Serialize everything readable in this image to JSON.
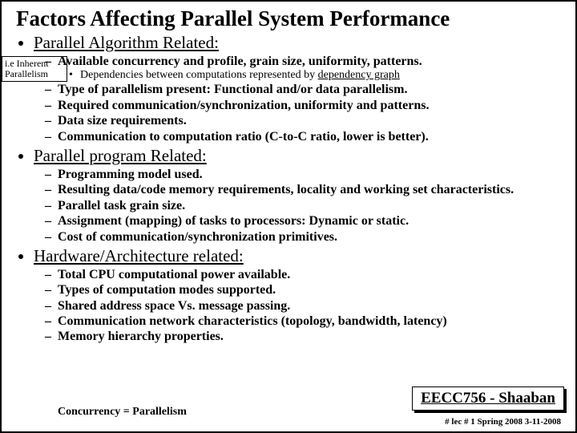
{
  "title": "Factors Affecting Parallel System Performance",
  "callout": "i.e Inherent Parallelism",
  "sections": [
    {
      "heading": "Parallel Algorithm Related:",
      "items": [
        {
          "text": "Available concurrency and profile, grain size, uniformity, patterns."
        },
        {
          "dep": {
            "pre": "Dependencies between computations represented by ",
            "und": "dependency graph"
          }
        },
        {
          "text": "Type of parallelism present: Functional and/or data parallelism."
        },
        {
          "text": "Required communication/synchronization, uniformity and patterns."
        },
        {
          "text": "Data size requirements."
        },
        {
          "text": "Communication to computation ratio  (C-to-C ratio, lower is better)."
        }
      ]
    },
    {
      "heading": "Parallel program Related:",
      "items": [
        {
          "text": "Programming model used."
        },
        {
          "text": "Resulting data/code memory requirements, locality and working set characteristics."
        },
        {
          "text": "Parallel task grain size."
        },
        {
          "text": "Assignment (mapping) of tasks to processors: Dynamic or static."
        },
        {
          "text": "Cost of communication/synchronization primitives."
        }
      ]
    },
    {
      "heading": "Hardware/Architecture related:",
      "items": [
        {
          "text": "Total CPU computational power available."
        },
        {
          "text": "Types of computation modes supported."
        },
        {
          "text": "Shared address space Vs. message passing."
        },
        {
          "text": "Communication network characteristics (topology, bandwidth, latency)"
        },
        {
          "text": "Memory hierarchy properties."
        }
      ]
    }
  ],
  "footer": {
    "left": "Concurrency = Parallelism",
    "brand": "EECC756 - Shaaban",
    "right": "#  lec # 1    Spring 2008   3-11-2008"
  }
}
